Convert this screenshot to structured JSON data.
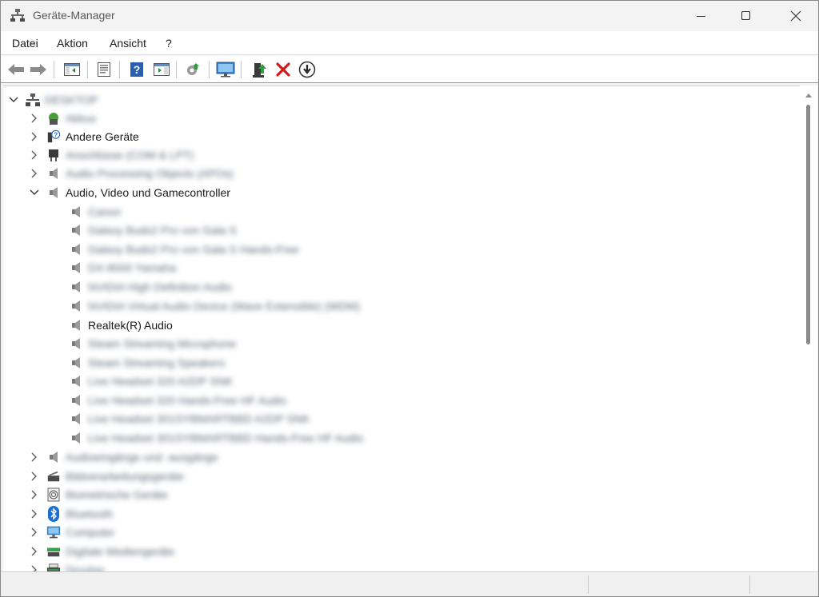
{
  "window": {
    "title": "Geräte-Manager",
    "controls": {
      "minimize": "minimize-icon",
      "maximize": "maximize-icon",
      "close": "close-icon"
    }
  },
  "menu": {
    "items": [
      {
        "label": "Datei"
      },
      {
        "label": "Aktion"
      },
      {
        "label": "Ansicht"
      },
      {
        "label": "?"
      }
    ]
  },
  "toolbar": {
    "buttons": [
      {
        "icon": "back-arrow-icon"
      },
      {
        "icon": "forward-arrow-icon"
      },
      {
        "icon": "show-hide-console-tree-icon"
      },
      {
        "icon": "properties-icon"
      },
      {
        "icon": "help-icon"
      },
      {
        "icon": "show-action-pane-icon"
      },
      {
        "icon": "scan-hardware-changes-icon"
      },
      {
        "icon": "monitor-icon"
      },
      {
        "icon": "update-driver-icon"
      },
      {
        "icon": "uninstall-device-icon"
      },
      {
        "icon": "disable-device-icon"
      }
    ]
  },
  "tree": {
    "root": {
      "label": "DESKTOP",
      "blurred": true
    },
    "categories": [
      {
        "label": "Akkus",
        "blurred": true,
        "expanded": false
      },
      {
        "label": "Andere Geräte",
        "blurred": false,
        "expanded": false
      },
      {
        "label": "Anschlüsse (COM & LPT)",
        "blurred": true,
        "expanded": false
      },
      {
        "label": "Audio Processing Objects (APOs)",
        "blurred": true,
        "expanded": false
      },
      {
        "label": "Audio, Video und Gamecontroller",
        "blurred": false,
        "expanded": true,
        "children": [
          {
            "label": "Canon",
            "blurred": true
          },
          {
            "label": "Galaxy Buds2 Pro von Gala S",
            "blurred": true
          },
          {
            "label": "Galaxy Buds2 Pro von Gala S Hands-Free",
            "blurred": true
          },
          {
            "label": "DX-8000 Yamaha",
            "blurred": true
          },
          {
            "label": "NVIDIA High Definition Audio",
            "blurred": true
          },
          {
            "label": "NVIDIA Virtual Audio Device (Wave Extensible) (WDM)",
            "blurred": true
          },
          {
            "label": "Realtek(R) Audio",
            "blurred": false
          },
          {
            "label": "Steam Streaming Microphone",
            "blurred": true
          },
          {
            "label": "Steam Streaming Speakers",
            "blurred": true
          },
          {
            "label": "Live Headset 320 A2DP SNK",
            "blurred": true
          },
          {
            "label": "Live Headset 320 Hands-Free HF Audio",
            "blurred": true
          },
          {
            "label": "Live Headset 301SYBMARTBBD A2DP SNK",
            "blurred": true
          },
          {
            "label": "Live Headset 301SYBMARTBBD Hands-Free HF Audio",
            "blurred": true
          }
        ]
      },
      {
        "label": "Audioeingänge und -ausgänge",
        "blurred": true,
        "expanded": false
      },
      {
        "label": "Bildverarbeitungsgeräte",
        "blurred": true,
        "expanded": false
      },
      {
        "label": "Biometrische Geräte",
        "blurred": true,
        "expanded": false
      },
      {
        "label": "Bluetooth",
        "blurred": true,
        "expanded": false
      },
      {
        "label": "Computer",
        "blurred": true,
        "expanded": false
      },
      {
        "label": "Digitale Mediengeräte",
        "blurred": true,
        "expanded": false
      },
      {
        "label": "Drucker",
        "blurred": true,
        "expanded": false
      }
    ]
  },
  "colors": {
    "accent_blue": "#1a6fd6",
    "uninstall_red": "#d21a1a",
    "update_green": "#2e9e3e"
  }
}
